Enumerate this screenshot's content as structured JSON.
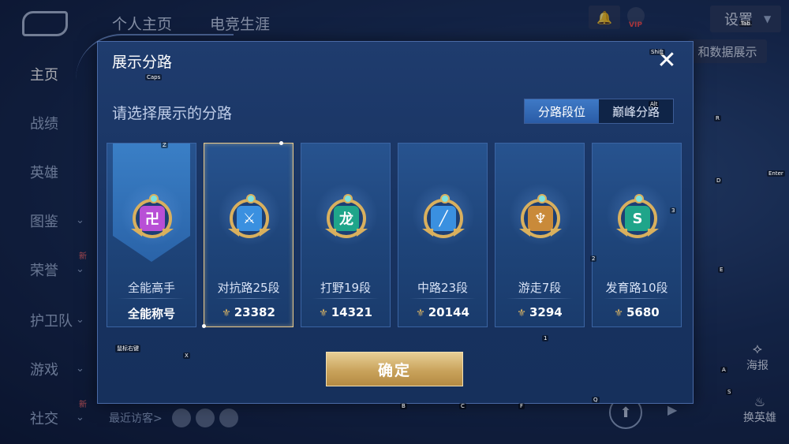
{
  "background": {
    "top_tabs": [
      "个人主页",
      "电竞生涯"
    ],
    "sidebar": [
      {
        "label": "主页",
        "active": true,
        "chevron": false,
        "new": false
      },
      {
        "label": "战绩",
        "active": false,
        "chevron": false,
        "new": false
      },
      {
        "label": "英雄",
        "active": false,
        "chevron": false,
        "new": false
      },
      {
        "label": "图鉴",
        "active": false,
        "chevron": true,
        "new": false
      },
      {
        "label": "荣誉",
        "active": false,
        "chevron": true,
        "new": true
      },
      {
        "label": "护卫队",
        "active": false,
        "chevron": true,
        "new": false
      },
      {
        "label": "游戏",
        "active": false,
        "chevron": true,
        "new": false
      },
      {
        "label": "社交",
        "active": false,
        "chevron": true,
        "new": true
      }
    ],
    "new_badge": "新",
    "vip_tag": "VIP",
    "settings_label": "设置",
    "data_display_label": "和数据展示",
    "recent_visitors": "最近访客>",
    "report_label": "海报",
    "change_hero_label": "换英雄"
  },
  "modal": {
    "title": "展示分路",
    "subtitle": "请选择展示的分路",
    "toggle": [
      "分路段位",
      "巅峰分路"
    ],
    "toggle_active": 0,
    "cards": [
      {
        "name": "全能高手",
        "value": "全能称号",
        "show_power": false,
        "emblem_color": "#b84fd6",
        "emblem_glyph": "卍",
        "banner": true,
        "selected": false
      },
      {
        "name": "对抗路25段",
        "value": "23382",
        "show_power": true,
        "emblem_color": "#3a90e0",
        "emblem_glyph": "⚔",
        "banner": false,
        "selected": true
      },
      {
        "name": "打野19段",
        "value": "14321",
        "show_power": true,
        "emblem_color": "#1fa58a",
        "emblem_glyph": "龙",
        "banner": false,
        "selected": false
      },
      {
        "name": "中路23段",
        "value": "20144",
        "show_power": true,
        "emblem_color": "#3a90e0",
        "emblem_glyph": "╱",
        "banner": false,
        "selected": false
      },
      {
        "name": "游走7段",
        "value": "3294",
        "show_power": true,
        "emblem_color": "#c98a3a",
        "emblem_glyph": "♆",
        "banner": false,
        "selected": false
      },
      {
        "name": "发育路10段",
        "value": "5680",
        "show_power": true,
        "emblem_color": "#1fa58a",
        "emblem_glyph": "S",
        "banner": false,
        "selected": false
      }
    ],
    "confirm_label": "确定"
  },
  "key_hints": {
    "caps": "Caps",
    "shift": "Shift",
    "alt": "Alt",
    "tab": "Tab",
    "enter": "Enter",
    "z": "Z",
    "x": "X",
    "r": "R",
    "d": "D",
    "e": "E",
    "a": "A",
    "s": "S",
    "b": "B",
    "c": "C",
    "f": "F",
    "q": "Q",
    "n1": "1",
    "n2": "2",
    "n3": "3",
    "mouse": "鼠标右键"
  }
}
